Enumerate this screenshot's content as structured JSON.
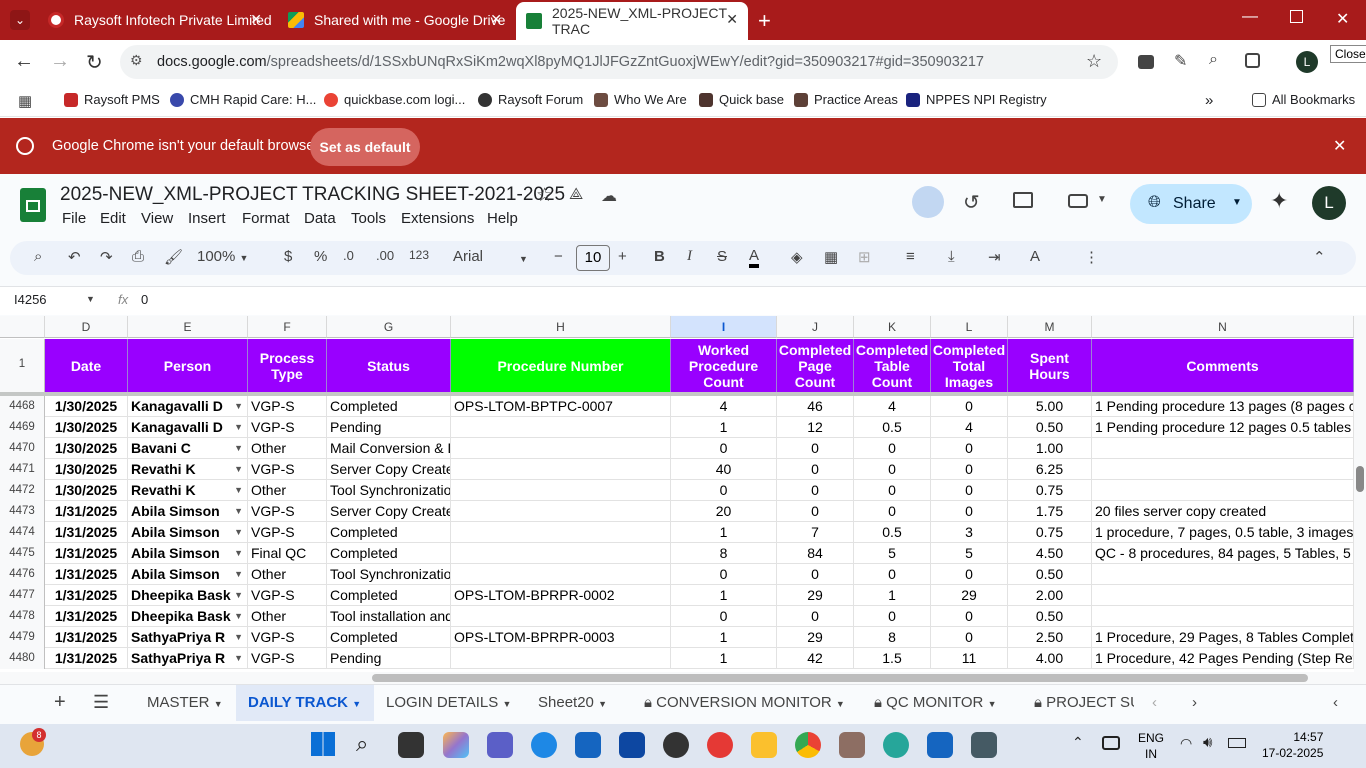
{
  "browser": {
    "tabs": [
      {
        "title": "Raysoft Infotech Private Limited",
        "color": "#e8eaed"
      },
      {
        "title": "Shared with me - Google Drive",
        "color": "#fbbc04"
      },
      {
        "title": "2025-NEW_XML-PROJECT TRAC",
        "color": "#188038"
      }
    ],
    "url_host": "docs.google.com",
    "url_path": "/spreadsheets/d/1SSxbUNqRxSiKm2wqXl8pyMQ1JlJFGzZntGuoxjWEwY/edit?gid=350903217#gid=350903217",
    "close_tooltip": "Close",
    "profile_initial": "L",
    "bookmarks": [
      "Raysoft PMS",
      "CMH Rapid Care: H...",
      "quickbase.com logi...",
      "Raysoft Forum",
      "Who We Are",
      "Quick base",
      "Practice Areas",
      "NPPES NPI Registry"
    ],
    "all_bookmarks": "All Bookmarks",
    "infobar_text": "Google Chrome isn't your default browser",
    "infobar_button": "Set as default"
  },
  "sheets": {
    "title": "2025-NEW_XML-PROJECT TRACKING SHEET-2021-2025",
    "menus": [
      "File",
      "Edit",
      "View",
      "Insert",
      "Format",
      "Data",
      "Tools",
      "Extensions",
      "Help"
    ],
    "share_label": "Share",
    "zoom": "100%",
    "currency": "$",
    "percent": "%",
    "dec_less": ".0",
    "dec_more": ".00",
    "number_fmt": "123",
    "font": "Arial",
    "font_size": "10",
    "cell_ref": "I4256",
    "formula_value": "0",
    "fx": "fx"
  },
  "grid": {
    "columns": [
      "D",
      "E",
      "F",
      "G",
      "H",
      "I",
      "J",
      "K",
      "L",
      "M",
      "N"
    ],
    "header_row_number": "1",
    "headers": [
      "Date",
      "Person",
      "Process Type",
      "Status",
      "Procedure Number",
      "Worked Procedure Count",
      "Completed Page Count",
      "Completed Table Count",
      "Completed Total Images",
      "Spent Hours",
      "Comments"
    ],
    "header_bg": "#9900ff",
    "header_green": "#00ff00",
    "rows": [
      [
        "4468",
        "1/30/2025",
        "Kanagavalli D",
        "VGP-S",
        "Completed",
        "OPS-LTOM-BPTPC-0007",
        "4",
        "46",
        "4",
        "0",
        "5.00",
        "1 Pending procedure 13 pages (8 pages co"
      ],
      [
        "4469",
        "1/30/2025",
        "Kanagavalli D",
        "VGP-S",
        "Pending",
        "",
        "1",
        "12",
        "0.5",
        "4",
        "0.50",
        "1 Pending procedure 12 pages 0.5 tables 4"
      ],
      [
        "4470",
        "1/30/2025",
        "Bavani C",
        "Other",
        "Mail Conversion & D",
        "",
        "0",
        "0",
        "0",
        "0",
        "1.00",
        ""
      ],
      [
        "4471",
        "1/30/2025",
        "Revathi K",
        "VGP-S",
        "Server Copy Createc",
        "",
        "40",
        "0",
        "0",
        "0",
        "6.25",
        ""
      ],
      [
        "4472",
        "1/30/2025",
        "Revathi K",
        "Other",
        "Tool Synchronizatior",
        "",
        "0",
        "0",
        "0",
        "0",
        "0.75",
        ""
      ],
      [
        "4473",
        "1/31/2025",
        "Abila Simson",
        "VGP-S",
        "Server Copy Createc",
        "",
        "20",
        "0",
        "0",
        "0",
        "1.75",
        "20 files server copy created"
      ],
      [
        "4474",
        "1/31/2025",
        "Abila Simson",
        "VGP-S",
        "Completed",
        "",
        "1",
        "7",
        "0.5",
        "3",
        "0.75",
        "1 procedure, 7 pages, 0.5 table, 3 images co"
      ],
      [
        "4475",
        "1/31/2025",
        "Abila Simson",
        "Final QC",
        "Completed",
        "",
        "8",
        "84",
        "5",
        "5",
        "4.50",
        "QC - 8 procedures, 84 pages, 5 Tables, 5 im"
      ],
      [
        "4476",
        "1/31/2025",
        "Abila Simson",
        "Other",
        "Tool Synchronizatior",
        "",
        "0",
        "0",
        "0",
        "0",
        "0.50",
        ""
      ],
      [
        "4477",
        "1/31/2025",
        "Dheepika Bask",
        "VGP-S",
        "Completed",
        "OPS-LTOM-BPRPR-0002",
        "1",
        "29",
        "1",
        "29",
        "2.00",
        ""
      ],
      [
        "4478",
        "1/31/2025",
        "Dheepika Bask",
        "Other",
        "Tool installation and",
        "",
        "0",
        "0",
        "0",
        "0",
        "0.50",
        ""
      ],
      [
        "4479",
        "1/31/2025",
        "SathyaPriya R",
        "VGP-S",
        "Completed",
        "OPS-LTOM-BPRPR-0003",
        "1",
        "29",
        "8",
        "0",
        "2.50",
        "1 Procedure, 29 Pages, 8 Tables Completed"
      ],
      [
        "4480",
        "1/31/2025",
        "SathyaPriya R",
        "VGP-S",
        "Pending",
        "",
        "1",
        "42",
        "1.5",
        "11",
        "4.00",
        "1 Procedure, 42 Pages Pending (Step Ref. I"
      ]
    ]
  },
  "sheet_tabs": [
    "MASTER",
    "DAILY TRACK",
    "LOGIN DETAILS",
    "Sheet20",
    "CONVERSION MONITOR",
    "QC MONITOR",
    "PROJECT SU"
  ],
  "taskbar": {
    "badge": "8",
    "lang_top": "ENG",
    "lang_bottom": "IN",
    "time": "14:57",
    "date": "17-02-2025"
  }
}
